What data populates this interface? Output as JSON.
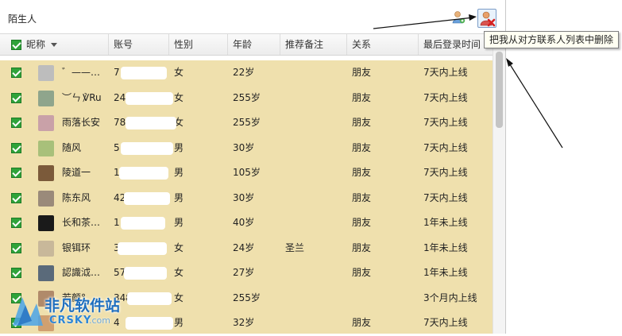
{
  "window": {
    "title": "陌生人"
  },
  "toolbar": {
    "add_icon": "person-add-icon",
    "delete_icon": "person-delete-icon",
    "delete_tooltip": "把我从对方联系人列表中删除"
  },
  "columns": [
    "昵称",
    "账号",
    "性别",
    "年龄",
    "推荐备注",
    "关系",
    "最后登录时间"
  ],
  "rows": [
    {
      "nickname": "゛——…",
      "account": "7",
      "gender": "女",
      "age": "22岁",
      "note": "",
      "relation": "朋友",
      "last_login": "7天内上线"
    },
    {
      "nickname": "︶ㄣ ℣Ru",
      "account": "24",
      "gender": "女",
      "age": "255岁",
      "note": "",
      "relation": "朋友",
      "last_login": "7天内上线"
    },
    {
      "nickname": "雨落长安",
      "account": "78",
      "gender": "女",
      "age": "255岁",
      "note": "",
      "relation": "朋友",
      "last_login": "7天内上线"
    },
    {
      "nickname": "随风",
      "account": "5",
      "gender": "男",
      "age": "30岁",
      "note": "",
      "relation": "朋友",
      "last_login": "7天内上线"
    },
    {
      "nickname": "陵道一",
      "account": "1",
      "gender": "男",
      "age": "105岁",
      "note": "",
      "relation": "朋友",
      "last_login": "7天内上线"
    },
    {
      "nickname": "陈东风",
      "account": "42",
      "gender": "男",
      "age": "30岁",
      "note": "",
      "relation": "朋友",
      "last_login": "7天内上线"
    },
    {
      "nickname": "长和茶…",
      "account": "1",
      "gender": "男",
      "age": "40岁",
      "note": "",
      "relation": "朋友",
      "last_login": "1年未上线"
    },
    {
      "nickname": "银铒环",
      "account": "3",
      "gender": "女",
      "age": "24岁",
      "note": "圣兰",
      "relation": "朋友",
      "last_login": "1年未上线"
    },
    {
      "nickname": "認識泧…",
      "account": "57",
      "gender": "女",
      "age": "27岁",
      "note": "",
      "relation": "朋友",
      "last_login": "1年未上线"
    },
    {
      "nickname": "若颜°",
      "account": "348",
      "gender": "女",
      "age": "255岁",
      "note": "",
      "relation": "",
      "last_login": "3个月内上线"
    },
    {
      "nickname": "",
      "account": "4",
      "gender": "男",
      "age": "32岁",
      "note": "",
      "relation": "朋友",
      "last_login": "7天内上线"
    }
  ],
  "watermark": {
    "main": "非凡软件站",
    "sub": "CRSKY",
    "sub2": ".com"
  },
  "colors": {
    "row_bg": "#efe0ad",
    "checkbox": "#2fa33a",
    "accent": "#1f6fbf"
  }
}
